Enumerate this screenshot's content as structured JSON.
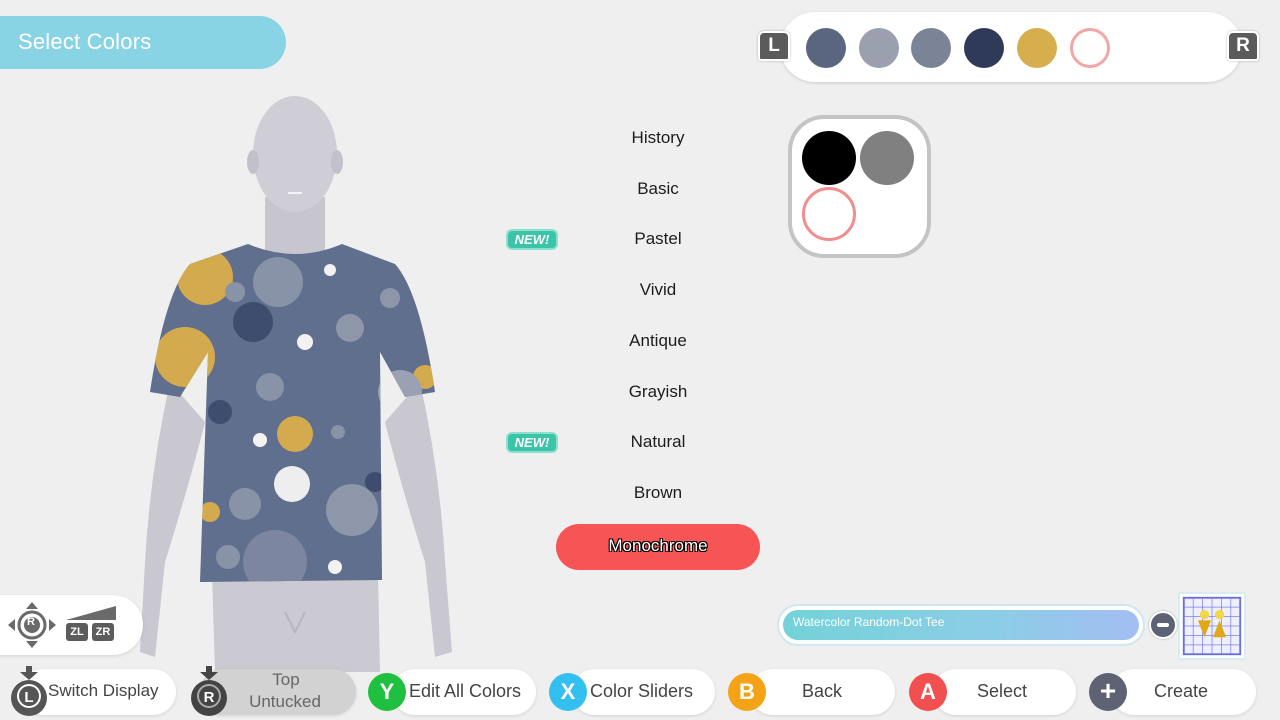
{
  "header": {
    "title": "Select Colors"
  },
  "palette": {
    "left_shoulder": "L",
    "right_shoulder": "R",
    "swatches": [
      {
        "color": "#5a6580"
      },
      {
        "color": "#9aa0ae"
      },
      {
        "color": "#7b8497"
      },
      {
        "color": "#2e3a57"
      },
      {
        "color": "#d7ae4e"
      },
      {
        "color": "#ffffff",
        "outline": "#f4a5a5"
      }
    ]
  },
  "preview": {
    "colors": [
      "#000000",
      "#808080",
      "#ffffff"
    ],
    "outline_color": "#f28d8d"
  },
  "categories": {
    "items": [
      {
        "label": "History",
        "new": false
      },
      {
        "label": "Basic",
        "new": false
      },
      {
        "label": "Pastel",
        "new": true
      },
      {
        "label": "Vivid",
        "new": false
      },
      {
        "label": "Antique",
        "new": false
      },
      {
        "label": "Grayish",
        "new": false
      },
      {
        "label": "Natural",
        "new": true
      },
      {
        "label": "Brown",
        "new": false
      },
      {
        "label": "Monochrome",
        "new": false,
        "selected": true
      }
    ],
    "new_badge_label": "NEW!"
  },
  "camera_controls": {
    "stick": "R",
    "zl": "ZL",
    "zr": "ZR"
  },
  "item": {
    "name": "Watercolor Random-Dot Tee"
  },
  "footer": {
    "switch_display": {
      "button": "L",
      "label": "Switch Display"
    },
    "top_untucked": {
      "button": "R",
      "label_line1": "Top",
      "label_line2": "Untucked"
    },
    "edit_all_colors": {
      "button": "Y",
      "label": "Edit All Colors",
      "color": "#1fbf3f"
    },
    "color_sliders": {
      "button": "X",
      "label": "Color Sliders",
      "color": "#33c0ee"
    },
    "back": {
      "button": "B",
      "label": "Back",
      "color": "#f5a316"
    },
    "select": {
      "button": "A",
      "label": "Select",
      "color": "#f25050"
    },
    "create": {
      "button": "+",
      "label": "Create",
      "color": "#5d6275"
    }
  },
  "colors": {
    "accent_title": "#89d4e4",
    "selected_category": "#f75555",
    "new_badge": "#3cc4a8",
    "shirt_base": "#5f6f8d"
  }
}
